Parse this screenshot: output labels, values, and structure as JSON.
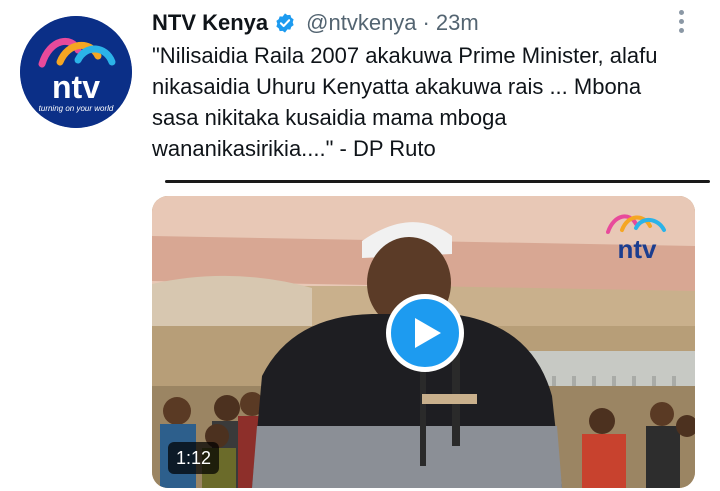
{
  "tweet": {
    "display_name": "NTV Kenya",
    "handle": "@ntvkenya",
    "separator": "·",
    "time": "23m",
    "text": "\"Nilisaidia Raila 2007 akakuwa Prime Minister, alafu nikasaidia Uhuru Kenyatta akakuwa rais ... Mbona sasa nikitaka kusaidia mama mboga wananikasirikia....\" - DP Ruto",
    "verified": true,
    "avatar_logo_text": "ntv",
    "avatar_tagline": "turning on your world"
  },
  "media": {
    "duration": "1:12",
    "watermark_text": "ntv",
    "play_icon": "play-icon"
  },
  "colors": {
    "accent": "#1d9bf0",
    "secondary_text": "#536471",
    "avatar_bg": "#0b2f87"
  }
}
